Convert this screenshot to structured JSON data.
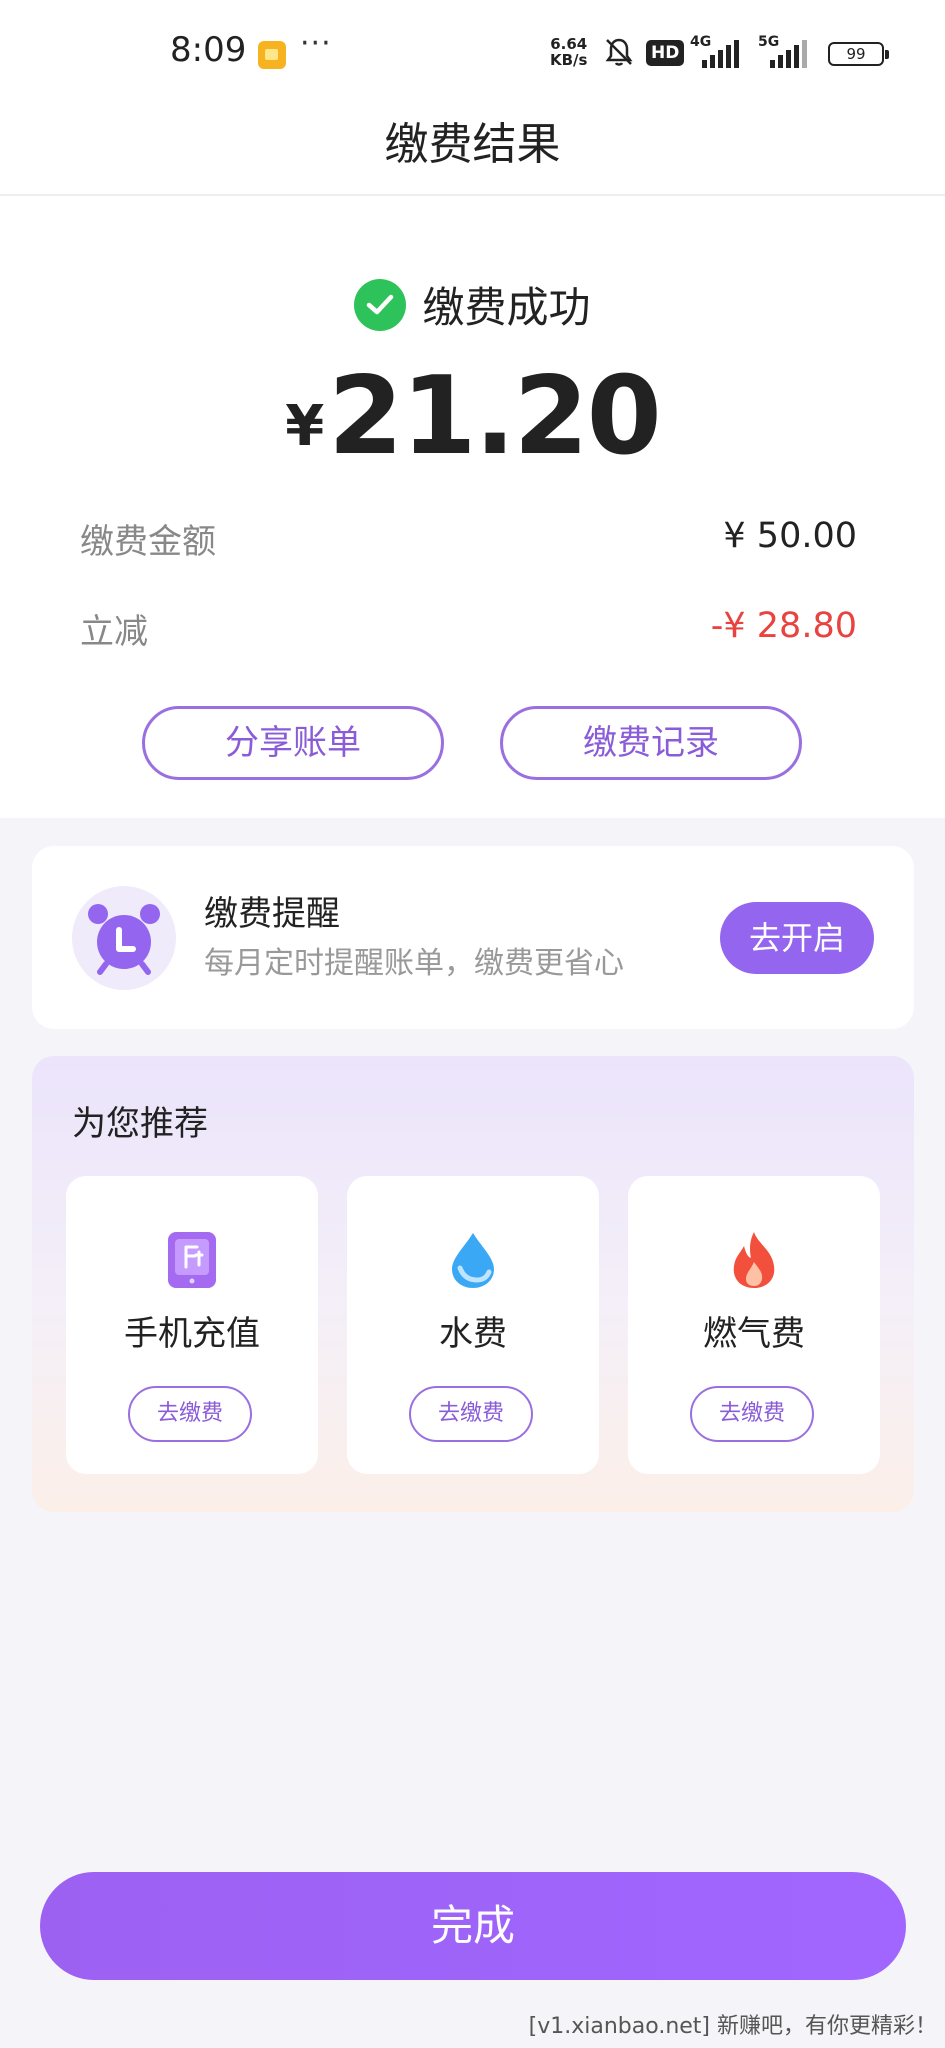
{
  "status_bar": {
    "time": "8:09",
    "more": "···",
    "net_speed_value": "6.64",
    "net_speed_unit": "KB/s",
    "hd_label": "HD",
    "signal_1_label": "4G",
    "signal_2_label": "5G",
    "battery": "99"
  },
  "header": {
    "title": "缴费结果"
  },
  "result": {
    "status_text": "缴费成功",
    "currency": "¥",
    "amount": "21.20",
    "rows": [
      {
        "label": "缴费金额",
        "value": "¥ 50.00"
      },
      {
        "label": "立减",
        "value": "-¥ 28.80"
      }
    ],
    "share_button": "分享账单",
    "history_button": "缴费记录"
  },
  "reminder": {
    "title": "缴费提醒",
    "description": "每月定时提醒账单，缴费更省心",
    "button": "去开启"
  },
  "recommend": {
    "title": "为您推荐",
    "items": [
      {
        "name": "手机充值",
        "button": "去缴费",
        "icon": "phone-recharge-icon"
      },
      {
        "name": "水费",
        "button": "去缴费",
        "icon": "water-drop-icon"
      },
      {
        "name": "燃气费",
        "button": "去缴费",
        "icon": "flame-icon"
      }
    ]
  },
  "footer": {
    "done_button": "完成"
  },
  "watermark": "[v1.xianbao.net] 新赚吧，有你更精彩！",
  "colors": {
    "accent": "#9466f0",
    "success": "#2ec35a",
    "discount": "#e8433f"
  }
}
